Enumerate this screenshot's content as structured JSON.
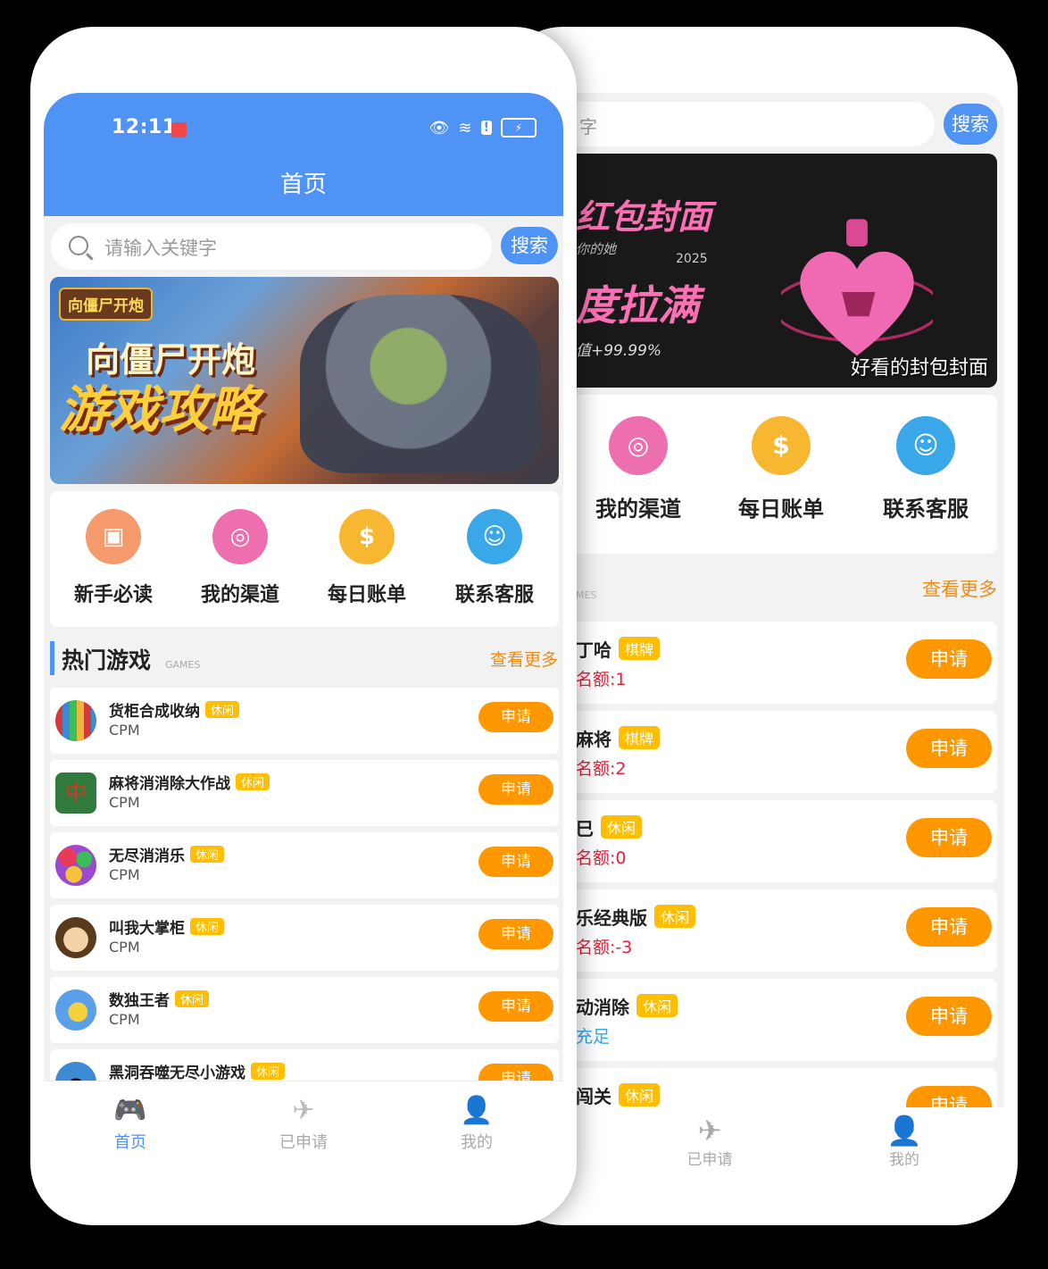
{
  "front": {
    "status_time": "12:11",
    "page_title": "首页",
    "search": {
      "placeholder": "请输入关键字",
      "button": "搜索"
    },
    "banner": {
      "tag": "向僵尸开炮",
      "line1": "向僵尸开炮",
      "line2": "游戏攻略"
    },
    "menu": [
      {
        "label": "新手必读",
        "icon": "guide-icon",
        "color": "#f49a6c"
      },
      {
        "label": "我的渠道",
        "icon": "channel-icon",
        "color": "#ee6fb0"
      },
      {
        "label": "每日账单",
        "icon": "bill-icon",
        "color": "#f7b731"
      },
      {
        "label": "联系客服",
        "icon": "service-icon",
        "color": "#3aa7e8"
      }
    ],
    "section": {
      "title": "热门游戏",
      "subtitle": "GAMES",
      "more": "查看更多"
    },
    "games": [
      {
        "name": "货柜合成收纳",
        "tag": "休闲",
        "sub": "CPM",
        "button": "申请"
      },
      {
        "name": "麻将消消除大作战",
        "tag": "休闲",
        "sub": "CPM",
        "button": "申请"
      },
      {
        "name": "无尽消消乐",
        "tag": "休闲",
        "sub": "CPM",
        "button": "申请"
      },
      {
        "name": "叫我大掌柜",
        "tag": "休闲",
        "sub": "CPM",
        "button": "申请"
      },
      {
        "name": "数独王者",
        "tag": "休闲",
        "sub": "CPM",
        "button": "申请"
      },
      {
        "name": "黑洞吞噬无尽小游戏",
        "tag": "休闲",
        "sub": "",
        "button": "申请"
      }
    ],
    "tabs": [
      {
        "label": "首页",
        "icon": "gamepad-icon",
        "active": true
      },
      {
        "label": "已申请",
        "icon": "paper-plane-icon",
        "active": false
      },
      {
        "label": "我的",
        "icon": "user-icon",
        "active": false
      }
    ]
  },
  "back": {
    "search": {
      "placeholder": "字",
      "button": "搜索"
    },
    "banner": {
      "line1": "红包封面",
      "sub": "你的她",
      "year": "2025",
      "line2": "度拉满",
      "pct": "值+99.99%",
      "caption": "好看的封包封面"
    },
    "menu": [
      {
        "label": "我的渠道",
        "icon": "channel-icon",
        "color": "#ee6fb0"
      },
      {
        "label": "每日账单",
        "icon": "bill-icon",
        "color": "#f7b731"
      },
      {
        "label": "联系客服",
        "icon": "service-icon",
        "color": "#3aa7e8"
      }
    ],
    "section": {
      "subtitle": "MES",
      "more": "查看更多"
    },
    "games": [
      {
        "name": "丁哈",
        "tag": "棋牌",
        "sub": "名额:1",
        "button": "申请"
      },
      {
        "name": "麻将",
        "tag": "棋牌",
        "sub": "名额:2",
        "button": "申请"
      },
      {
        "name": "巳",
        "tag": "休闲",
        "sub": "名额:0",
        "button": "申请"
      },
      {
        "name": "乐经典版",
        "tag": "休闲",
        "sub": "名额:-3",
        "button": "申请"
      },
      {
        "name": "动消除",
        "tag": "休闲",
        "sub": "充足",
        "button": "申请"
      },
      {
        "name": "闯关",
        "tag": "休闲",
        "sub": "",
        "button": "申请"
      }
    ],
    "tabs": [
      {
        "label": "已申请",
        "icon": "paper-plane-icon"
      },
      {
        "label": "我的",
        "icon": "user-icon"
      }
    ]
  },
  "colors": {
    "primary": "#4f93f5",
    "accent": "#ff9800",
    "tag": "#ffbf00",
    "quota": "#e8203c"
  }
}
